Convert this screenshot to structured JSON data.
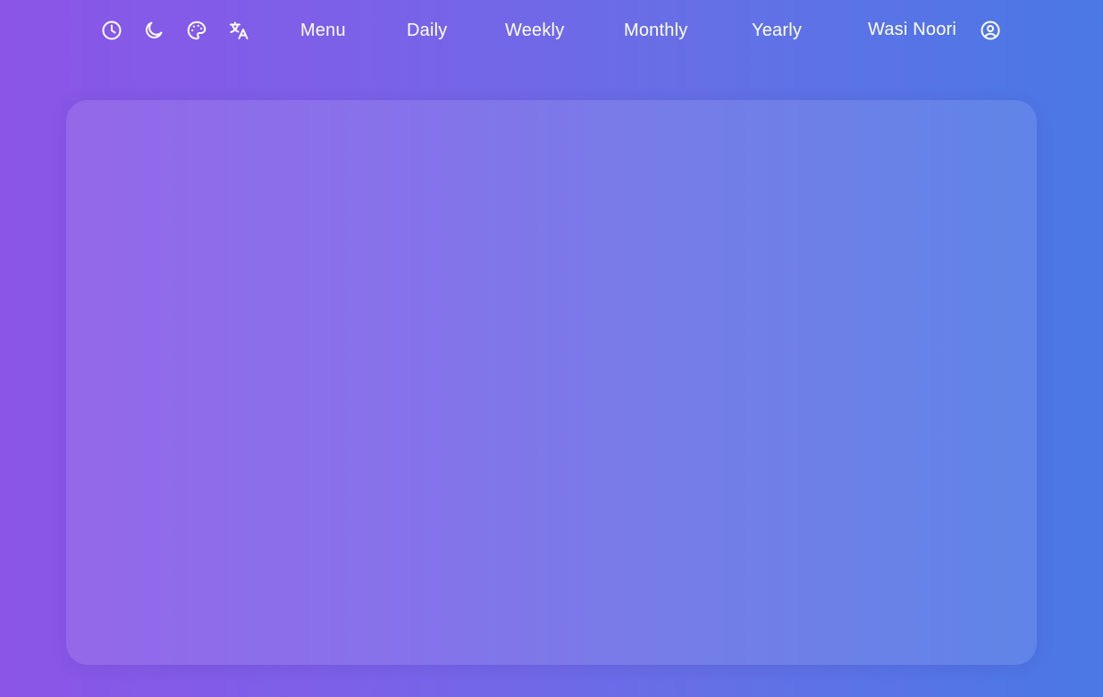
{
  "header": {
    "icons": {
      "clock": "clock-icon",
      "theme": "moon-icon",
      "palette": "palette-icon",
      "language": "translate-icon",
      "account": "user-circle-icon"
    },
    "nav": {
      "menu": "Menu",
      "daily": "Daily",
      "weekly": "Weekly",
      "monthly": "Monthly",
      "yearly": "Yearly"
    },
    "user": {
      "name": "Wasi Noori"
    }
  },
  "colors": {
    "gradient_start": "#8b55e7",
    "gradient_end": "#4a78e5",
    "text": "#ffffff"
  }
}
